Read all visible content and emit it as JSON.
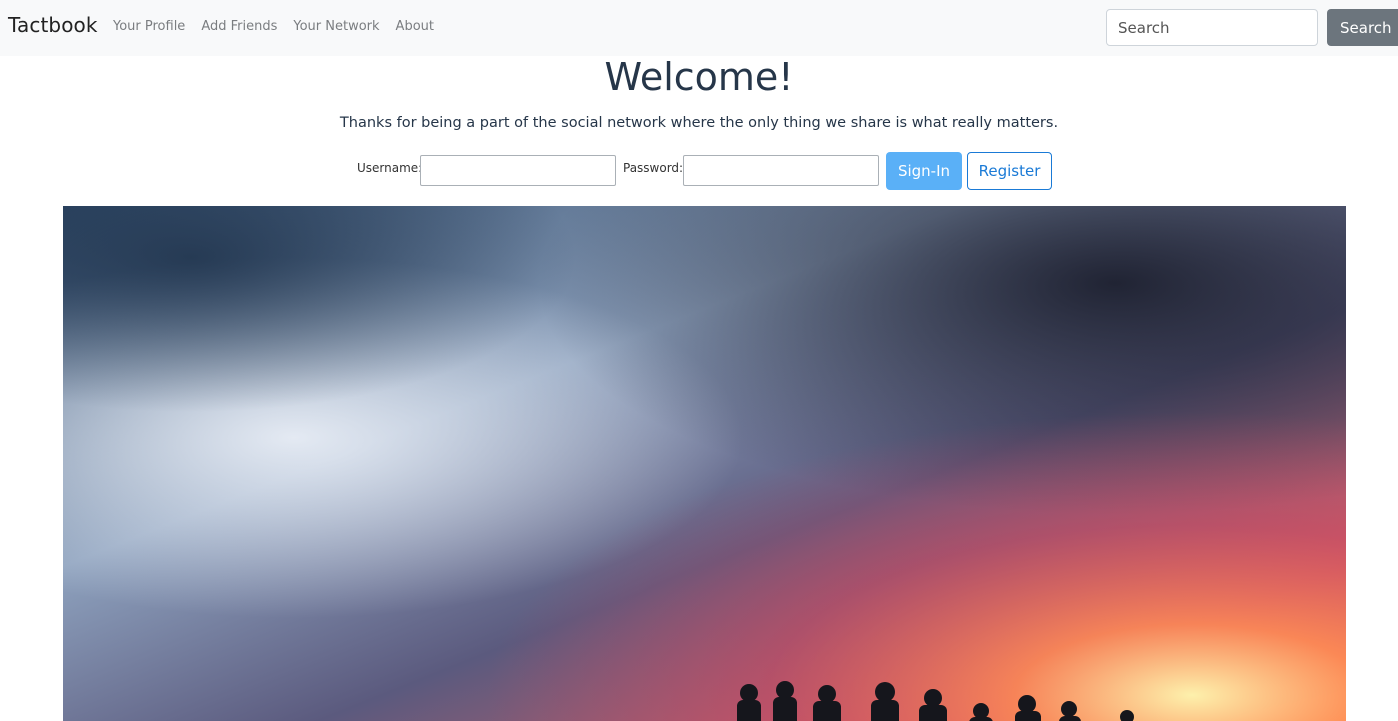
{
  "navbar": {
    "brand": "Tactbook",
    "links": [
      "Your Profile",
      "Add Friends",
      "Your Network",
      "About"
    ],
    "search_placeholder": "Search",
    "search_button": "Search"
  },
  "main": {
    "title": "Welcome!",
    "subtitle": "Thanks for being a part of the social network where the only thing we share is what really matters.",
    "login": {
      "username_label": "Username:",
      "username_value": "",
      "password_label": "Password:",
      "password_value": "",
      "signin_label": "Sign-In",
      "register_label": "Register"
    }
  },
  "colors": {
    "navbar_bg": "#f8f9fa",
    "title_text": "#263649",
    "signin_bg": "#5ab0f7",
    "register_border": "#1a7ad6",
    "search_button_bg": "#6c757d"
  }
}
